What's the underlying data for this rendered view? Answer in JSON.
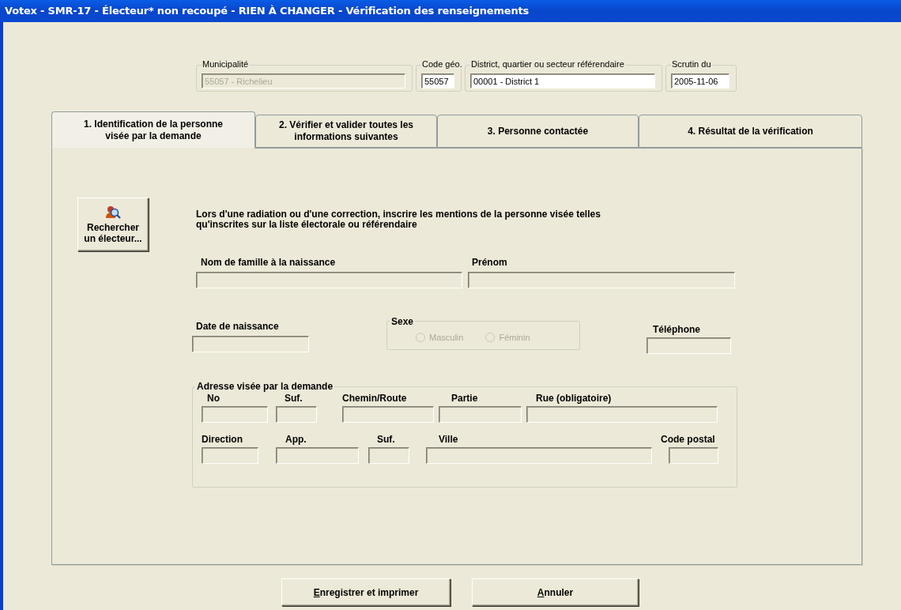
{
  "window": {
    "title": "Votex - SMR-17 - Électeur* non recoupé - RIEN À CHANGER - Vérification des renseignements"
  },
  "header_fields": [
    {
      "label": "Municipalité",
      "value": "55057 - Richelieu",
      "disabled": true
    },
    {
      "label": "Code géo.",
      "value": "55057",
      "disabled": false
    },
    {
      "label": "District, quartier ou secteur référendaire",
      "value": "00001 - District 1",
      "disabled": false
    },
    {
      "label": "Scrutin du",
      "value": "2005-11-06",
      "disabled": false
    }
  ],
  "tabs": [
    {
      "label": "1. Identification de la personne\nvisée par la demande",
      "selected": true
    },
    {
      "label": "2. Vérifier et valider toutes les\ninformations suivantes",
      "selected": false
    },
    {
      "label": "3. Personne contactée",
      "selected": false
    },
    {
      "label": "4. Résultat de la vérification",
      "selected": false
    }
  ],
  "search_button": {
    "label": "Rechercher\nun électeur..."
  },
  "instructions": "Lors d'une radiation ou d'une correction, inscrire les mentions de la personne visée telles\nqu'inscrites sur la liste électorale ou référendaire",
  "person_fields": [
    {
      "label": "Nom de famille à la naissance",
      "disabled": true
    },
    {
      "label": "Prénom",
      "disabled": true
    },
    {
      "label": "Date de naissance",
      "disabled": true
    },
    {
      "label": "Téléphone",
      "disabled": true
    }
  ],
  "sex": {
    "label": "Sexe",
    "options": [
      {
        "label": "Masculin",
        "selected": false,
        "disabled": true
      },
      {
        "label": "Féminin",
        "selected": false,
        "disabled": true
      }
    ]
  },
  "address": {
    "label": "Adresse visée par la demande",
    "rows": [
      [
        {
          "label": "No",
          "disabled": true
        },
        {
          "label": "Suf.",
          "disabled": true
        },
        {
          "label": "Chemin/Route",
          "disabled": true
        },
        {
          "label": "Partie",
          "disabled": true
        },
        {
          "label": "Rue (obligatoire)",
          "disabled": true
        }
      ],
      [
        {
          "label": "Direction",
          "disabled": true
        },
        {
          "label": "App.",
          "disabled": true
        },
        {
          "label": "Suf.",
          "disabled": true
        },
        {
          "label": "Ville",
          "disabled": true
        },
        {
          "label": "Code postal",
          "disabled": true
        }
      ]
    ]
  },
  "buttons": [
    {
      "label": "Enregistrer et imprimer",
      "mnemonic_underlined": true
    },
    {
      "label": "Annuler",
      "mnemonic_underlined": true
    }
  ]
}
